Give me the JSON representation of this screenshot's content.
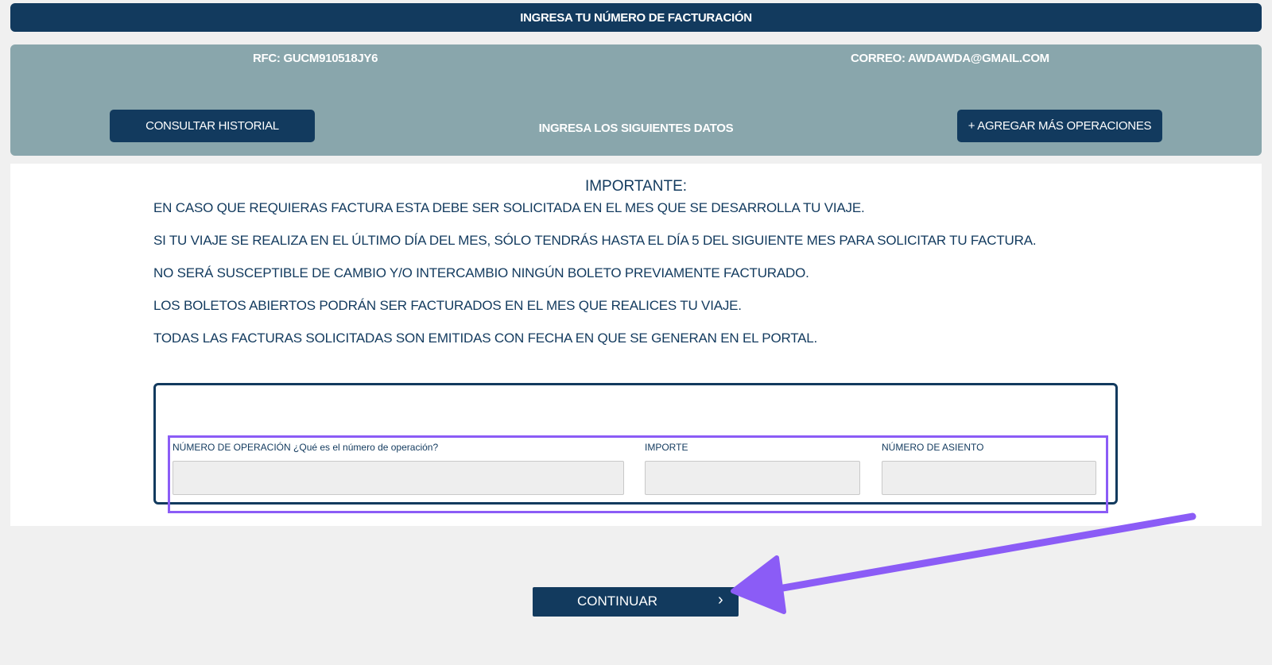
{
  "header": {
    "title": "INGRESA TU NÚMERO DE FACTURACIÓN"
  },
  "info_panel": {
    "rfc": "RFC: GUCM910518JY6",
    "correo": "CORREO: AWDAWDA@GMAIL.COM",
    "history_button": "CONSULTAR HISTORIAL",
    "center_text": "INGRESA LOS SIGUIENTES DATOS",
    "add_button": "+ AGREGAR MÁS OPERACIONES"
  },
  "important": {
    "title": "IMPORTANTE:",
    "notes": [
      "EN CASO QUE REQUIERAS FACTURA ESTA DEBE SER SOLICITADA EN EL MES QUE SE DESARROLLA TU VIAJE.",
      "SI TU VIAJE SE REALIZA EN EL ÚLTIMO DÍA DEL MES, SÓLO TENDRÁS HASTA EL DÍA 5 DEL SIGUIENTE MES PARA SOLICITAR TU FACTURA.",
      "NO SERÁ SUSCEPTIBLE DE CAMBIO Y/O INTERCAMBIO NINGÚN BOLETO PREVIAMENTE FACTURADO.",
      "LOS BOLETOS ABIERTOS PODRÁN SER FACTURADOS EN EL MES QUE REALICES TU VIAJE.",
      "TODAS LAS FACTURAS SOLICITADAS SON EMITIDAS CON FECHA EN QUE SE GENERAN EN EL PORTAL."
    ]
  },
  "form": {
    "operation_label": "NÚMERO DE OPERACIÓN",
    "operation_help": "¿Qué es el número de operación?",
    "operation_value": "",
    "amount_label": "IMPORTE",
    "amount_value": "",
    "seat_label": "NÚMERO DE ASIENTO",
    "seat_value": ""
  },
  "continue_button": {
    "label": "CONTINUAR",
    "icon": "chevron-right-icon"
  },
  "colors": {
    "primary": "#123a5e",
    "panel": "#89a6ac",
    "background": "#f0f0f0",
    "annotation": "#8b5cf6"
  }
}
